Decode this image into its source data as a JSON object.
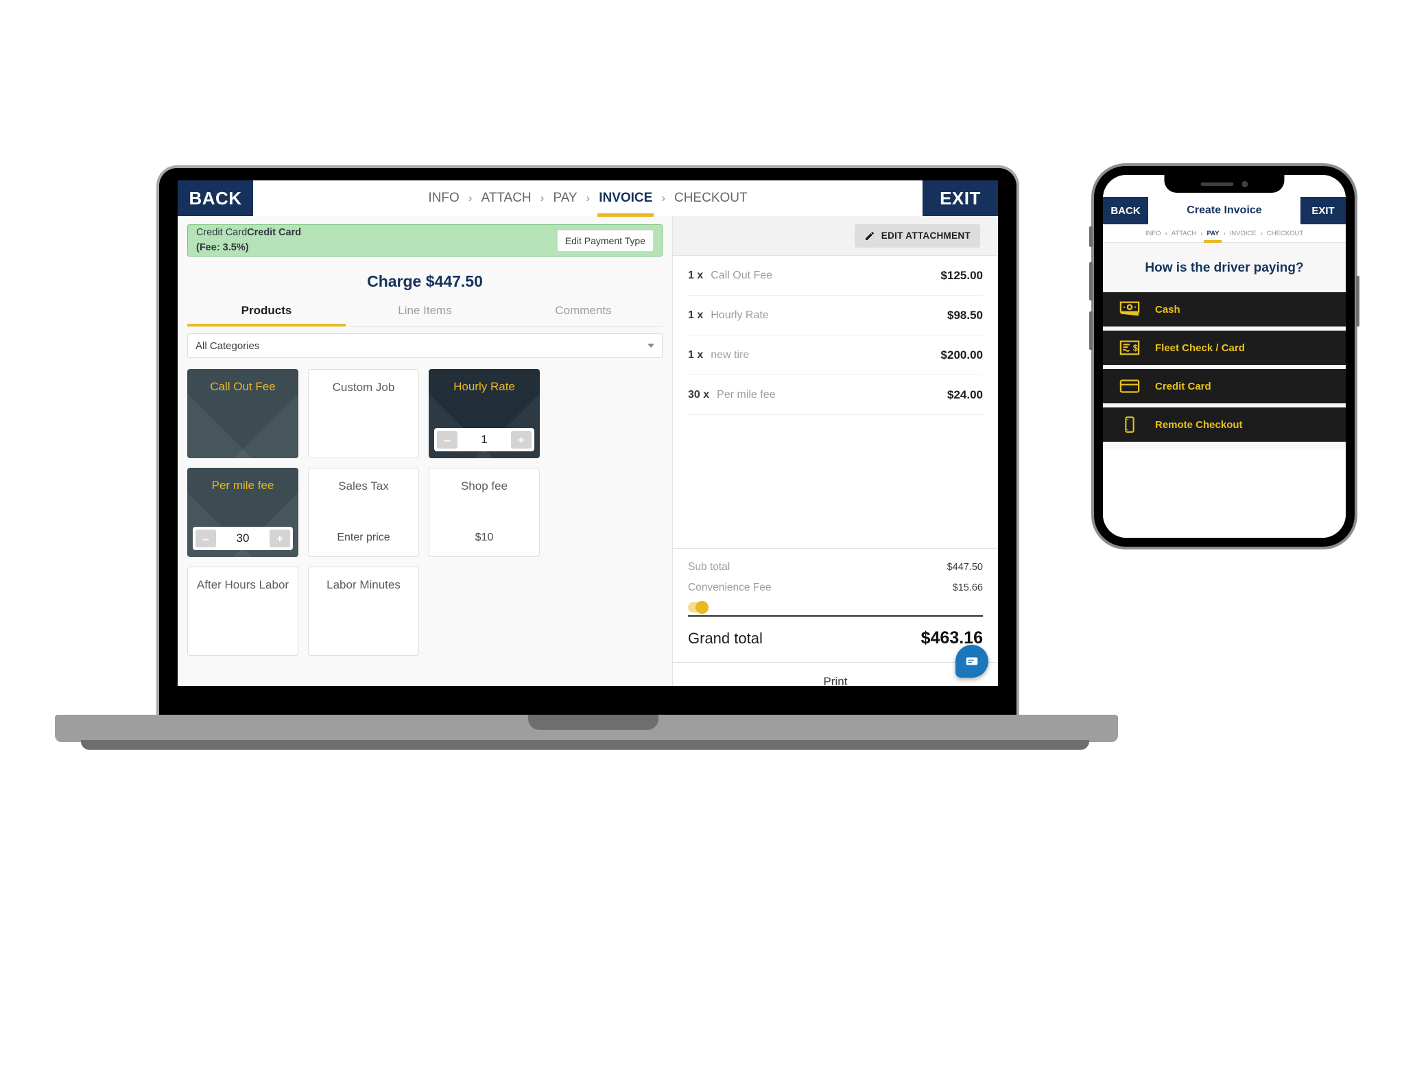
{
  "laptop": {
    "topbar": {
      "back_label": "BACK",
      "exit_label": "EXIT",
      "breadcrumb": [
        {
          "label": "INFO",
          "active": false
        },
        {
          "label": "ATTACH",
          "active": false
        },
        {
          "label": "PAY",
          "active": false
        },
        {
          "label": "INVOICE",
          "active": true
        },
        {
          "label": "CHECKOUT",
          "active": false
        }
      ],
      "separator": "›"
    },
    "payment_banner": {
      "type_prefix": "Credit Card",
      "type_name": "Credit Card",
      "fee_text": "(Fee: 3.5%)",
      "edit_button": "Edit Payment Type",
      "bg_color": "#b5e3b7"
    },
    "charge_heading": "Charge $447.50",
    "tabs": [
      {
        "label": "Products",
        "active": true
      },
      {
        "label": "Line Items",
        "active": false
      },
      {
        "label": "Comments",
        "active": false
      }
    ],
    "category_select": {
      "value": "All Categories"
    },
    "product_tiles": [
      {
        "label": "Call Out Fee",
        "style": "dark",
        "sub": "",
        "stepper": null
      },
      {
        "label": "Custom Job",
        "style": "light",
        "sub": "",
        "stepper": null
      },
      {
        "label": "Hourly Rate",
        "style": "darker",
        "sub": "",
        "stepper": {
          "value": "1",
          "minus": "–",
          "plus": "+"
        }
      },
      {
        "label": "Per mile fee",
        "style": "dark",
        "sub": "",
        "stepper": {
          "value": "30",
          "minus": "–",
          "plus": "+"
        }
      },
      {
        "label": "Sales Tax",
        "style": "light",
        "sub": "Enter price",
        "stepper": null
      },
      {
        "label": "Shop fee",
        "style": "light",
        "sub": "$10",
        "stepper": null
      },
      {
        "label": "After Hours Labor",
        "style": "light",
        "sub": "",
        "stepper": null
      },
      {
        "label": "Labor Minutes",
        "style": "light",
        "sub": "",
        "stepper": null
      }
    ],
    "invoice": {
      "edit_attachment_label": "EDIT ATTACHMENT",
      "line_items": [
        {
          "qty": "1 x",
          "name": "Call Out Fee",
          "price": "$125.00"
        },
        {
          "qty": "1 x",
          "name": "Hourly Rate",
          "price": "$98.50"
        },
        {
          "qty": "1 x",
          "name": "new tire",
          "price": "$200.00"
        },
        {
          "qty": "30 x",
          "name": "Per mile fee",
          "price": "$24.00"
        }
      ],
      "subtotal_label": "Sub total",
      "subtotal_value": "$447.50",
      "convenience_label": "Convenience Fee",
      "convenience_value": "$15.66",
      "grand_label": "Grand total",
      "grand_value": "$463.16",
      "print_label": "Print"
    }
  },
  "phone": {
    "back_label": "BACK",
    "title": "Create Invoice",
    "exit_label": "EXIT",
    "breadcrumb": [
      {
        "label": "INFO",
        "active": false
      },
      {
        "label": "ATTACH",
        "active": false
      },
      {
        "label": "PAY",
        "active": true
      },
      {
        "label": "INVOICE",
        "active": false
      },
      {
        "label": "CHECKOUT",
        "active": false
      }
    ],
    "separator": "›",
    "question": "How is the driver paying?",
    "options": [
      {
        "label": "Cash",
        "icon": "cash-bill-icon"
      },
      {
        "label": "Fleet Check / Card",
        "icon": "fleet-check-icon"
      },
      {
        "label": "Credit Card",
        "icon": "credit-card-icon"
      },
      {
        "label": "Remote Checkout",
        "icon": "mobile-phone-icon"
      }
    ],
    "accent_color": "#e8c21e",
    "navy_color": "#16325c"
  }
}
